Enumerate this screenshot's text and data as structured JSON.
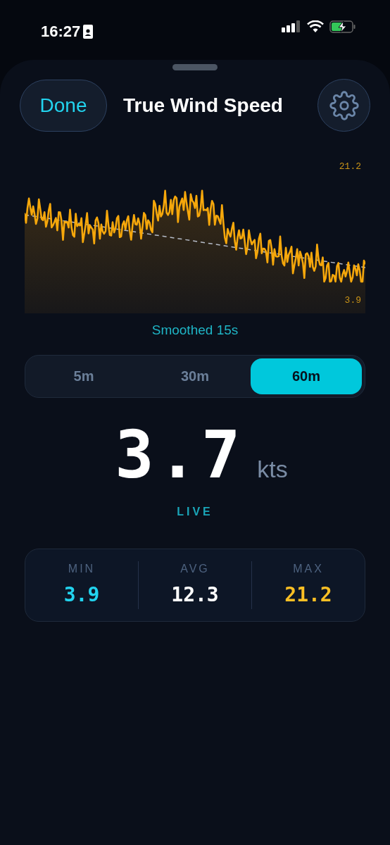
{
  "status_bar": {
    "time": "16:27"
  },
  "header": {
    "done_label": "Done",
    "title": "True Wind Speed"
  },
  "chart": {
    "max_label": "21.2",
    "min_label": "3.9",
    "caption": "Smoothed 15s"
  },
  "ranges": [
    {
      "label": "5m",
      "selected": false
    },
    {
      "label": "30m",
      "selected": false
    },
    {
      "label": "60m",
      "selected": true
    }
  ],
  "reading": {
    "value": "3.7",
    "unit": "kts",
    "status": "LIVE"
  },
  "stats": [
    {
      "label": "MIN",
      "value": "3.9",
      "color": "#22d3ee"
    },
    {
      "label": "AVG",
      "value": "12.3",
      "color": "#ffffff"
    },
    {
      "label": "MAX",
      "value": "21.2",
      "color": "#fbbf24"
    }
  ]
}
